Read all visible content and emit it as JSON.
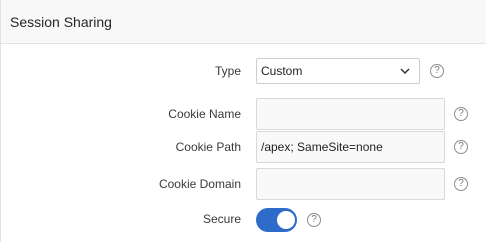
{
  "panel": {
    "title": "Session Sharing"
  },
  "form": {
    "type": {
      "label": "Type",
      "value": "Custom",
      "help": "?"
    },
    "cookie_name": {
      "label": "Cookie Name",
      "value": "",
      "help": "?"
    },
    "cookie_path": {
      "label": "Cookie Path",
      "value": "/apex; SameSite=none",
      "help": "?"
    },
    "cookie_domain": {
      "label": "Cookie Domain",
      "value": "",
      "help": "?"
    },
    "secure": {
      "label": "Secure",
      "enabled": true,
      "help": "?"
    }
  },
  "colors": {
    "toggle_on": "#2f6bc9",
    "header_bg": "#f8f8f8",
    "field_bg": "#f9f9f9"
  },
  "icons": {
    "dropdown": "chevron-down-icon",
    "help": "help-icon"
  }
}
